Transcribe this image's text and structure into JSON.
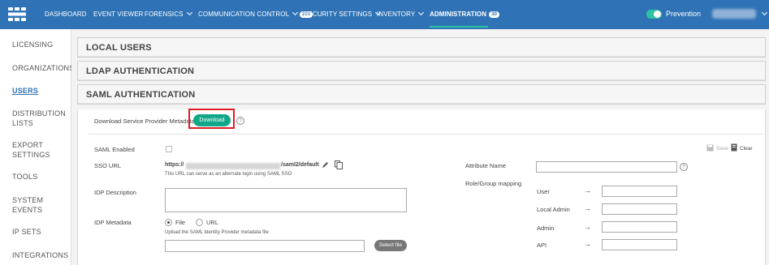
{
  "topnav": {
    "items": [
      {
        "label": "DASHBOARD"
      },
      {
        "label": "EVENT VIEWER"
      },
      {
        "label": "FORENSICS"
      },
      {
        "label": "COMMUNICATION CONTROL",
        "badge": "288"
      },
      {
        "label": "SECURITY SETTINGS"
      },
      {
        "label": "INVENTORY"
      },
      {
        "label": "ADMINISTRATION",
        "badge": "30"
      }
    ],
    "mode": "Prevention",
    "accent": "#2cc3a2",
    "bar_color": "#2f73b6"
  },
  "sidebar": {
    "items": [
      {
        "label": "LICENSING"
      },
      {
        "label": "ORGANIZATIONS"
      },
      {
        "label": "USERS"
      },
      {
        "label": "DISTRIBUTION"
      },
      {
        "label": "LISTS"
      },
      {
        "label": "EXPORT"
      },
      {
        "label": "SETTINGS"
      },
      {
        "label": "TOOLS"
      },
      {
        "label": "SYSTEM"
      },
      {
        "label": "EVENTS"
      },
      {
        "label": "IP SETS"
      },
      {
        "label": "INTEGRATIONS"
      }
    ]
  },
  "sections": {
    "local_users": "LOCAL USERS",
    "ldap": "LDAP AUTHENTICATION",
    "saml": "SAML AUTHENTICATION"
  },
  "saml": {
    "download_label": "Download Service Provider Metadata",
    "download_button": "Download",
    "help": "?",
    "saml_enabled": "SAML Enabled",
    "save": "Save",
    "clear": "Clear",
    "sso_url_label": "SSO URL",
    "sso_url_prefix": "https://",
    "sso_url_suffix": "/saml2/default",
    "sso_hint": "This URL can serve as an alternate login using SAML SSO",
    "idp_description": "IDP Description",
    "idp_metadata": "IDP Metadata",
    "radio_file": "File",
    "radio_url": "URL",
    "upload_hint": "Upload the SAML Identity Provider metadata file",
    "select_file": "Select file",
    "attribute_name": "Attribute Name",
    "role_mapping": "Role/Group mapping",
    "roles": [
      {
        "label": "User"
      },
      {
        "label": "Local Admin"
      },
      {
        "label": "Admin"
      },
      {
        "label": "API"
      }
    ],
    "arrow": "→"
  }
}
